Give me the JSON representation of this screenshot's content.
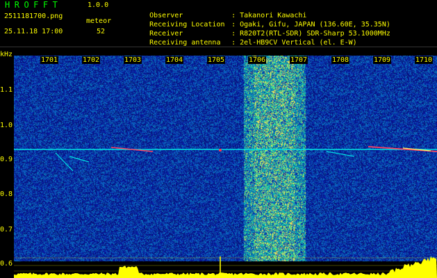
{
  "header": {
    "app_title": "HROFFT",
    "version": "1.0.0",
    "filename": "2511181700.png",
    "datetime": "25.11.18 17:00",
    "meteor_label": "meteor",
    "meteor_count": "52"
  },
  "station": {
    "rows": [
      {
        "key": "Observer",
        "value": "Takanori Kawachi"
      },
      {
        "key": "Receiving Location",
        "value": "Ogaki, Gifu, JAPAN (136.60E, 35.35N)"
      },
      {
        "key": "Receiver",
        "value": "R820T2(RTL-SDR) SDR-Sharp 53.1000MHz"
      },
      {
        "key": "Receiving antenna",
        "value": "2el-HB9CV Vertical (el. E-W)"
      }
    ],
    "separator": ":"
  },
  "axes": {
    "y_unit": "kHz",
    "y_ticks": [
      "1.1",
      "1.0",
      "0.9",
      "0.8",
      "0.7",
      "0.6"
    ],
    "x_ticks": [
      "1701",
      "1702",
      "1703",
      "1704",
      "1705",
      "1706",
      "1707",
      "1708",
      "1709",
      "1710"
    ]
  },
  "colors": {
    "background": "#000000",
    "text": "#ffff00",
    "title": "#00ff00",
    "spectrum_base": "#0b1a8f",
    "meteor_line": "#00e5e5",
    "histogram": "#ffff00"
  }
}
